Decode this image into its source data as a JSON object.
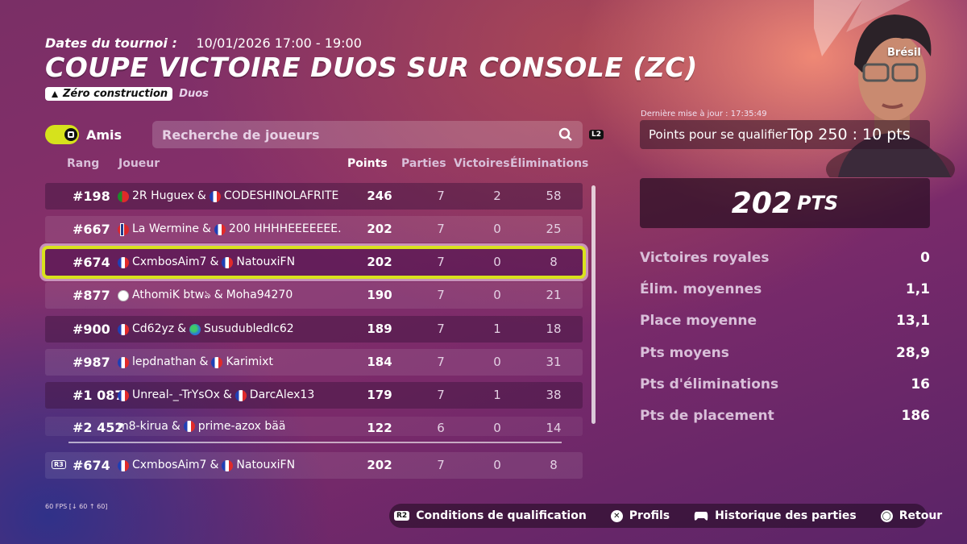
{
  "header": {
    "dates_label": "Dates du tournoi :",
    "dates_value": "10/01/2026 17:00 - 19:00",
    "title": "COUPE VICTOIRE DUOS SUR CONSOLE (ZC)",
    "tag_mode": "Zéro construction",
    "tag_type": "Duos"
  },
  "filters": {
    "friends_label": "Amis",
    "search_placeholder": "Recherche de joueurs",
    "search_hotkey": "L2"
  },
  "table": {
    "columns": [
      "Rang",
      "Joueur",
      "Points",
      "Parties",
      "Victoires",
      "Éliminations"
    ],
    "rows": [
      {
        "rank": "#198",
        "p1_flag": "pt",
        "p1": "2R Huguex",
        "p2_flag": "fr",
        "p2": "CODESHINOLAFRITE",
        "points": "246",
        "games": "7",
        "wins": "2",
        "elims": "58"
      },
      {
        "rank": "#667",
        "p1_flag": "no",
        "p1": "La Wermine",
        "p2_flag": "fr",
        "p2": "200 HHHHEEEEEEE.",
        "points": "202",
        "games": "7",
        "wins": "0",
        "elims": "25"
      },
      {
        "rank": "#674",
        "p1_flag": "fr",
        "p1": "CxmbosAim7",
        "p2_flag": "fr",
        "p2": "NatouxiFN",
        "points": "202",
        "games": "7",
        "wins": "0",
        "elims": "8"
      },
      {
        "rank": "#877",
        "p1_flag": "kr",
        "p1": "AthomiK btwঌ",
        "p2_flag": "",
        "p2": "Moha94270",
        "points": "190",
        "games": "7",
        "wins": "0",
        "elims": "21"
      },
      {
        "rank": "#900",
        "p1_flag": "fr",
        "p1": "Cd62yz",
        "p2_flag": "world",
        "p2": "SusudubledIc62",
        "points": "189",
        "games": "7",
        "wins": "1",
        "elims": "18"
      },
      {
        "rank": "#987",
        "p1_flag": "fr",
        "p1": "lepdnathan",
        "p2_flag": "fr",
        "p2": "Karimixt",
        "points": "184",
        "games": "7",
        "wins": "0",
        "elims": "31"
      },
      {
        "rank": "#1 087",
        "p1_flag": "fr",
        "p1": "Unreal-_-TrYsOx",
        "p2_flag": "fr",
        "p2": "DarcAlex13",
        "points": "179",
        "games": "7",
        "wins": "1",
        "elims": "38"
      },
      {
        "rank": "#2 452",
        "p1_flag": "",
        "p1": "m8-kirua",
        "p2_flag": "fr",
        "p2": "prime-azox bää",
        "points": "122",
        "games": "6",
        "wins": "0",
        "elims": "14"
      }
    ],
    "selected_index": 2,
    "own_row": {
      "rank": "#674",
      "p1_flag": "fr",
      "p1": "CxmbosAim7",
      "p2_flag": "fr",
      "p2": "NatouxiFN",
      "points": "202",
      "games": "7",
      "wins": "0",
      "elims": "8",
      "hotkey": "R3"
    }
  },
  "panel": {
    "region": "Brésil",
    "updated": "Dernière mise à jour : 17:35:49",
    "qualify_label": "Points pour se qualifier",
    "qualify_value": "Top 250 : 10 pts",
    "total_points": "202",
    "total_unit": "PTS",
    "stats": [
      {
        "label": "Victoires royales",
        "value": "0"
      },
      {
        "label": "Élim. moyennes",
        "value": "1,1"
      },
      {
        "label": "Place moyenne",
        "value": "13,1"
      },
      {
        "label": "Pts moyens",
        "value": "28,9"
      },
      {
        "label": "Pts d'éliminations",
        "value": "16"
      },
      {
        "label": "Pts de placement",
        "value": "186"
      }
    ]
  },
  "footer": {
    "fps": "60 FPS [↓ 60 ↑ 60]",
    "actions": [
      {
        "icon": "R2",
        "label": "Conditions de qualification"
      },
      {
        "icon": "cross",
        "label": "Profils"
      },
      {
        "icon": "gamepad",
        "label": "Historique des parties"
      },
      {
        "icon": "circle",
        "label": "Retour"
      }
    ]
  },
  "colors": {
    "accent": "#d9e21c",
    "background": "#862f6a"
  }
}
